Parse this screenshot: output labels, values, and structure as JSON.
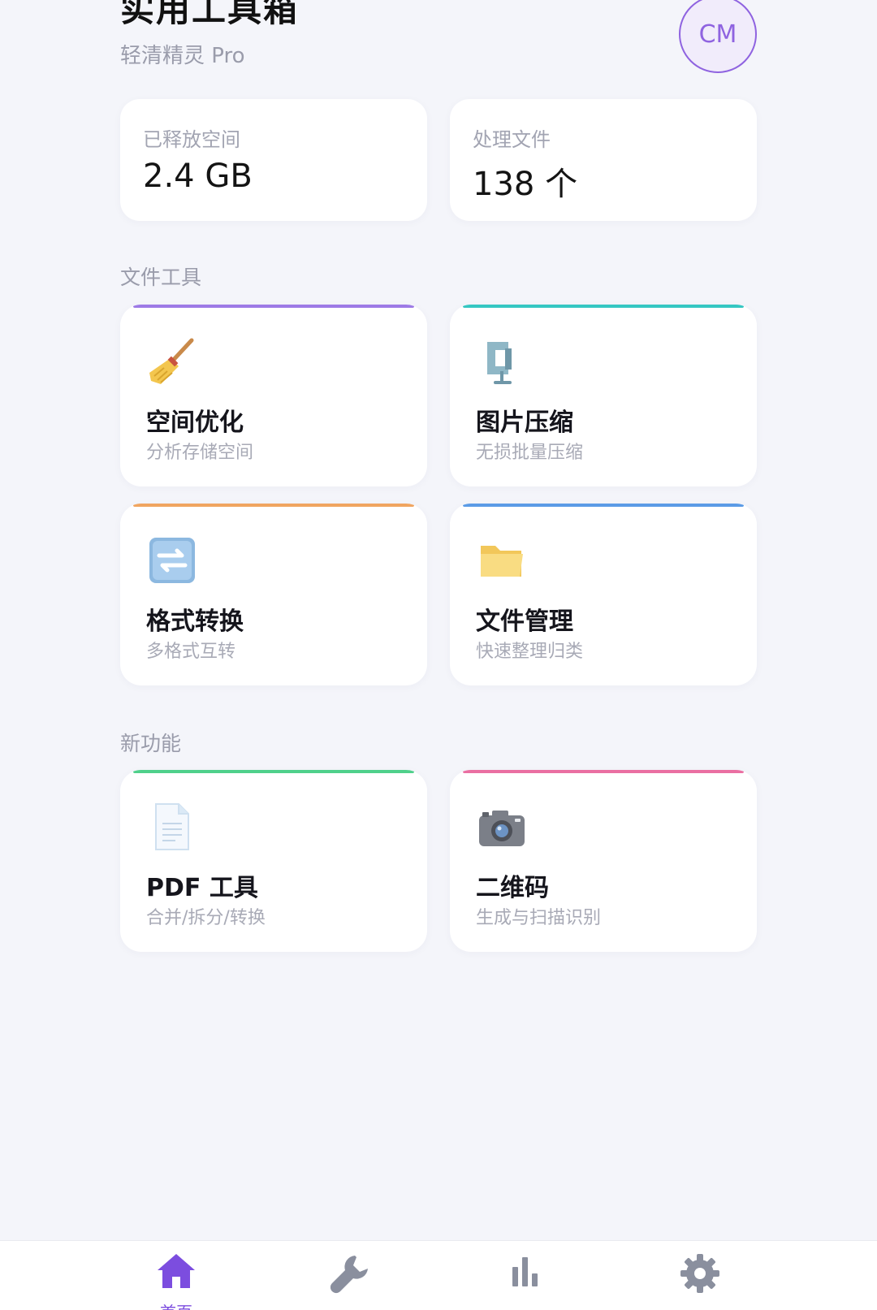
{
  "header": {
    "title": "实用工具箱",
    "subtitle": "轻清精灵 Pro",
    "avatar_initials": "CM"
  },
  "stats": [
    {
      "label": "已释放空间",
      "value": "2.4 GB"
    },
    {
      "label": "处理文件",
      "value": "138 个"
    }
  ],
  "sections": {
    "file_tools": {
      "title": "文件工具",
      "items": [
        {
          "name": "空间优化",
          "desc": "分析存储空间",
          "icon": "broom-icon",
          "accent": "#9d7ae6"
        },
        {
          "name": "图片压缩",
          "desc": "无损批量压缩",
          "icon": "clamp-icon",
          "accent": "#35c7c2"
        },
        {
          "name": "格式转换",
          "desc": "多格式互转",
          "icon": "convert-arrows-icon",
          "accent": "#f0a560"
        },
        {
          "name": "文件管理",
          "desc": "快速整理归类",
          "icon": "folder-icon",
          "accent": "#5b9be6"
        }
      ]
    },
    "new_features": {
      "title": "新功能",
      "items": [
        {
          "name": "PDF 工具",
          "desc": "合并/拆分/转换",
          "icon": "document-icon",
          "accent": "#4fd08b"
        },
        {
          "name": "二维码",
          "desc": "生成与扫描识别",
          "icon": "camera-icon",
          "accent": "#ea6fa2"
        }
      ]
    }
  },
  "tabbar": {
    "items": [
      {
        "icon": "home-icon",
        "active": true,
        "label": "首页"
      },
      {
        "icon": "wrench-icon",
        "active": false
      },
      {
        "icon": "bar-chart-icon",
        "active": false
      },
      {
        "icon": "gear-icon",
        "active": false
      }
    ]
  },
  "colors": {
    "brand": "#7c4ddf",
    "background": "#f4f5fa",
    "tab_inactive": "#8a8f9e"
  }
}
